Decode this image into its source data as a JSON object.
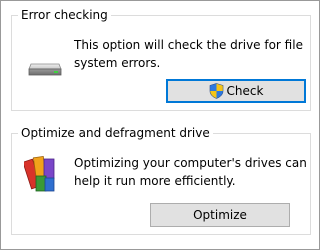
{
  "error_checking": {
    "title": "Error checking",
    "description_line1": "This option will check the drive for file",
    "description_line2": "system errors.",
    "button_label": "Check",
    "button_icon": "uac-shield-icon",
    "section_icon": "hard-drive-icon"
  },
  "optimize": {
    "title": "Optimize and defragment drive",
    "description_line1": "Optimizing your computer's drives can",
    "description_line2": "help it run more efficiently.",
    "button_label": "Optimize",
    "section_icon": "defragment-icon"
  },
  "colors": {
    "focus_border": "#0078d7",
    "button_face": "#e1e1e1",
    "group_border": "#dcdcdc"
  }
}
